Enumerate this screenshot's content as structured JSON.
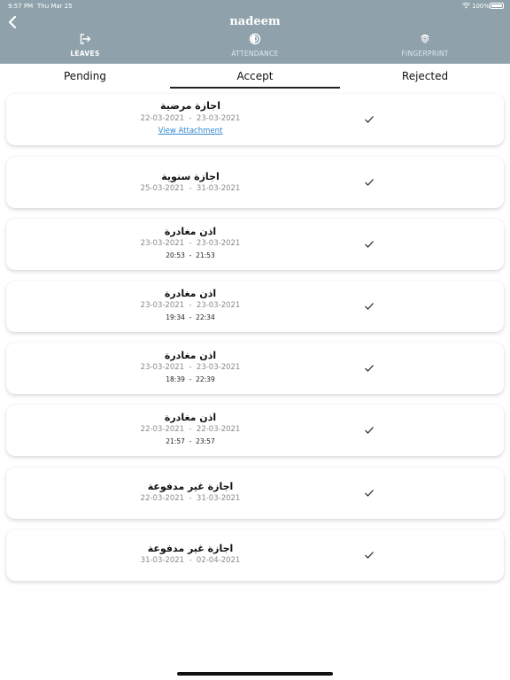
{
  "status_bar": {
    "time": "9:57 PM",
    "date": "Thu Mar 25",
    "battery": "100%"
  },
  "header": {
    "title": "nadeem"
  },
  "nav": [
    {
      "label": "LEAVES",
      "icon": "logout-icon",
      "active": true
    },
    {
      "label": "ATTENDANCE",
      "icon": "half-circle-icon",
      "active": false
    },
    {
      "label": "FINGERPRINT",
      "icon": "fingerprint-icon",
      "active": false
    }
  ],
  "tabs": [
    {
      "label": "Pending"
    },
    {
      "label": "Accept",
      "active": true
    },
    {
      "label": "Rejected"
    }
  ],
  "leaves": [
    {
      "title": "اجازة مرضية",
      "dates": "22-03-2021  -  23-03-2021",
      "link": "View Attachment"
    },
    {
      "title": "اجازة سنوية",
      "dates": "25-03-2021  -  31-03-2021"
    },
    {
      "title": "اذن مغادرة",
      "dates": "23-03-2021  -  23-03-2021",
      "times": "20:53  -  21:53"
    },
    {
      "title": "اذن مغادرة",
      "dates": "23-03-2021  -  23-03-2021",
      "times": "19:34  -  22:34"
    },
    {
      "title": "اذن مغادرة",
      "dates": "23-03-2021  -  23-03-2021",
      "times": "18:39  -  22:39"
    },
    {
      "title": "اذن مغادرة",
      "dates": "22-03-2021  -  22-03-2021",
      "times": "21:57  -  23:57"
    },
    {
      "title": "اجازة غير مدفوعة",
      "dates": "22-03-2021  -  31-03-2021"
    },
    {
      "title": "اجازة غير مدفوعة",
      "dates": "31-03-2021  -  02-04-2021"
    }
  ],
  "colors": {
    "header_bg": "#8fa2ab",
    "link": "#2f86d1"
  }
}
